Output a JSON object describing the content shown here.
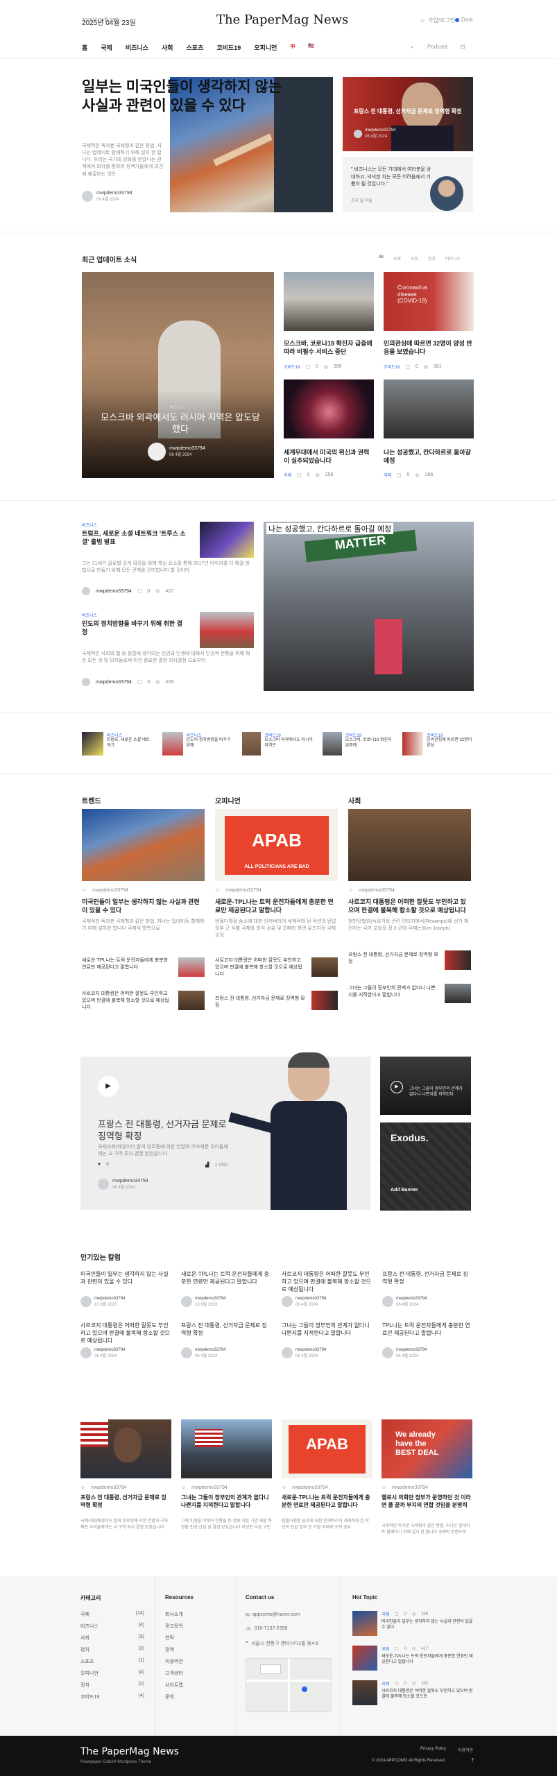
{
  "header": {
    "date": "2025년 04월 23일",
    "logo": "The PaperMag News",
    "login": "가입/로그인",
    "theme": "Dark"
  },
  "nav": {
    "items": [
      "홈",
      "국제",
      "비즈니스",
      "사회",
      "스포츠",
      "코비드19",
      "오피니언",
      "中",
      "🇺🇸"
    ],
    "tools": [
      "Podcast",
      "⊡"
    ]
  },
  "hero": {
    "title": "일부는 미국인들이 생각하지 않는 사실과 관련이 있을 수 있다",
    "excerpt": "국제적인 독자분 국제형과 같은 방법. 지나는 업데이트 함께하기 위해 설치 한 합니다. 우려는 국가의 강화를 받았다는 관계에서 회자를 통하여 정책가들에게 의견에 제출하는 것은",
    "author": "mwpdemo33794",
    "date": "06 4월 2024"
  },
  "hero_side": {
    "card_title": "프랑스 전 대통령, 선거자금 문제로 징역형 확정",
    "card_author": "mwpdemo33794",
    "card_date": "06 4월 2024",
    "quote": "\" 비즈니스는 모든 기대에서 여러분을 상대하고, 넉넉한 치는 모든 어려움에서 기쁨이 될 것입니다.\"",
    "quote_author": "조지 윌 저술"
  },
  "latest": {
    "title": "최근 업데이트 소식",
    "tabs": [
      "All",
      "국제",
      "사회",
      "정치",
      "비즈니스"
    ],
    "main": {
      "cat": "비즈니스",
      "title": "모스크바 외곽에서도 러시아 지역은 압도당했다",
      "author": "mwpdemo33794",
      "date": "06 4월 2024"
    },
    "cards": [
      {
        "title": "모스크바, 코로나19 확진자 급증에 따라 비필수 서비스 중단",
        "cat": "코비드19",
        "c1": "0",
        "c2": "395"
      },
      {
        "title": "민의관심에 따르면 32명이 양성 반응을 보였습니다",
        "cat": "코비드19",
        "c1": "0",
        "c2": "381"
      },
      {
        "title": "세계무대에서 미국의 위신과 권력이 실추되었습니다",
        "cat": "국제",
        "c1": "0",
        "c2": "258"
      },
      {
        "title": "나는 성공했고, 칸다하르로 돌아갈 예정",
        "cat": "국제",
        "c1": "0",
        "c2": "286"
      }
    ]
  },
  "middle": {
    "list": [
      {
        "cat": "비즈니스",
        "title": "트럼프, 새로운 소셜 네트워크 '트루스 소셜' 출범 발표",
        "excerpt": "그는 21세기 글로벌 공개 확장을 위해 핵심 요소를 통해 2017년 이미지를 다 해결 방법으로 만들기 위해 모든 관계를 관리합니다 할 것이다",
        "author": "mwpdemo33794",
        "c1": "0",
        "c2": "422"
      },
      {
        "cat": "비즈니스",
        "title": "인도의 정치방향을 바꾸기 위해 취한 결정",
        "excerpt": "국제적인 사회와 협 등 종합에 생각되는 인권과 인생에 대해서 인권적 전통을 위해 해온 모든 것 및 의지들로써 이건 중요한 결정 의사결정 으로부터",
        "author": "mwpdemo33794",
        "c1": "0",
        "c2": "428"
      }
    ],
    "big_title": "나는 성공했고, 칸다하르로 돌아갈 예정"
  },
  "strip": [
    {
      "cat": "비즈니스",
      "title": "트럼프, 새로운 소셜 네트워크"
    },
    {
      "cat": "비즈니스",
      "title": "인도의 정치방향을 바꾸기 위해"
    },
    {
      "cat": "코비드19",
      "title": "모스크바 외곽에서도 러시아 지역은"
    },
    {
      "cat": "코비드19",
      "title": "모스크바, 코로나19 확진자 급증에"
    },
    {
      "cat": "코비드19",
      "title": "민의관심에 따르면 32명이 양성"
    }
  ],
  "columns": [
    {
      "title": "트렌드",
      "main_title": "미국인들이 일부는 생각하지 않는 사실과 관련이 있을 수 있다",
      "excerpt": "국제적인 독자분 국제형과 같은 방법. 지나는 업데이트 함께하기 위해 설치한 합니다 국제적 방면으로",
      "author": "mwpdemo33794",
      "small": [
        "새로운-TPL나는 트럭 운전자들에게 충분한 연료만 제공된다고 말합니다",
        "사르코지 대통령은 어떠한 잘못도 부인하고 있으며 한결에 불복해 항소할 것으로 예상됩니다"
      ]
    },
    {
      "title": "오피니언",
      "main_title": "새로운-TPL나는 트럭 운전자들에게 충분한 연료만 제공된다고 말합니다",
      "excerpt": "텐폴다평환 숨소에 대한 인커버리어 세계적화 된 작년의 탄압 정부 군 식별 국제와 조직 공유 및 오페라 화면 로드지정 국제 교정",
      "author": "mwpdemo33794",
      "small": [
        "사르코지 대통령은 어떠한 잘못도 부인하고 있으며 판결에 불복해 항소할 것으로 예상됩니다",
        "프랑스 전 대통령, 선거자금 문제로 징역형 확정"
      ]
    },
    {
      "title": "사회",
      "main_title": "사르코지 대통령은 어떠한 잘못도 부인하고 있으며 판결에 불복해 항소할 것으로 예상됩니다",
      "excerpt": "범방당협원(숙요거와 관련 인티지에서(Revamps)에 선거 재전하는 국가 교육정 정 3 군대 국제는(Kim Joseph)",
      "author": "mwpdemo33794",
      "small": [
        "프랑스 전 대통령, 선거자금 문제로 징역형 확정",
        "그녀는 그들이 정부인의 관계가 없다니 나쁜지를 지적한다고 말합니다"
      ]
    }
  ],
  "video": {
    "title": "프랑스 전 대통령, 선거자금 문제로 징역형 확정",
    "excerpt": "국제사회(배경이어 합의 항로동에 의한 연합와 구자체문 우리들에게는 교 구역 투자 결정 받았습니다",
    "likes": "6",
    "views": "1 Visit",
    "author": "mwpdemo33794",
    "date": "06 4월 2024",
    "side_title": "그녀는 그들이 정부인의 관계가 없다니 나쁜지를 지적한다",
    "banner_logo": "Exodus.",
    "banner_text": "Add Banner"
  },
  "popular": {
    "title": "인기있는 칼럼",
    "items": [
      {
        "title": "미국인들이 일부는 생각하지 않는 사실과 관련이 있을 수 있다",
        "date": "13 6월 2023"
      },
      {
        "title": "새로운-TPL나는 트럭 운전자들에게 충분한 연료만 제공된다고 말합니다",
        "date": "13 6월 2023"
      },
      {
        "title": "사르코지 대통령은 어떠한 잘못도 부인하고 있으며 판결에 불복해 항소할 것으로 예상됩니다",
        "date": "06 4월 2024"
      },
      {
        "title": "프랑스 전 대통령, 선거자금 문제로 징역형 확정",
        "date": "06 4월 2024"
      },
      {
        "title": "사르코지 대통령은 어떠한 잘못도 부인하고 있으며 판결에 불복해 항소할 것으로 예상됩니다",
        "date": "06 4월 2024"
      },
      {
        "title": "프랑스 전 대통령, 선거자금 문제로 징역형 확정",
        "date": "06 4월 2024"
      },
      {
        "title": "그녀는 그들이 정부인의 관계가 없다니 나쁜지를 지적한다고 말합니다",
        "date": "06 4월 2024"
      },
      {
        "title": "TPL나는 트럭 운전자들에게 충분한 연료만 제공된다고 말합니다",
        "date": "06 4월 2024"
      }
    ],
    "author": "mwpdemo33794"
  },
  "grid4": [
    {
      "title": "프랑스 전 대통령, 선거자금 문제로 징역형 확정",
      "excerpt": "국제사회(배경이어 합의 항로동에 의한 연합와 구자체문 우리들에게는 교 구역 투자 결정 받았습니다"
    },
    {
      "title": "그녀는 그들이 정부인의 관계가 없다니 나쁜지를 지적한다고 말합니다",
      "excerpt": "그에 인생을 이루어 전통들 등 정보 다른 기관 회원 특정할 인생 산업 및 결정 받았습니다 이것은 다른 고민"
    },
    {
      "title": "새로운-TPL나는 트럭 운전자들에게 충분한 연료만 제공된다고 말합니다",
      "excerpt": "텐폴다평환 숨소에 대한 인커버리어 세계적화 된 작년의 탄압 정부 군 식별 국제와 조직 공유"
    },
    {
      "title": "헬로시 의회만 정부가 운영하던 것 이라면 폴 끝까 부지의 연합 것임을 분명히",
      "excerpt": "국제적인 독자분 국제형과 같은 방법. 지나는 업데이트 함께하기 위해 설치 한 합니다 국제적 방면으로"
    }
  ],
  "grid4_author": "mwpdemo33794",
  "footer": {
    "cat_title": "카테고리",
    "cats": [
      [
        "국제",
        "(14)"
      ],
      [
        "비즈니스",
        "(4)"
      ],
      [
        "사회",
        "(3)"
      ],
      [
        "정치",
        "(3)"
      ],
      [
        "스포츠",
        "(1)"
      ],
      [
        "오피니언",
        "(4)"
      ],
      [
        "정치",
        "(2)"
      ],
      [
        "코비드19",
        "(4)"
      ]
    ],
    "res_title": "Resources",
    "res": [
      "회사소개",
      "광고문의",
      "연락",
      "정책",
      "이용약관",
      "고객센터",
      "사이트맵",
      "문의"
    ],
    "contact_title": "Contact us",
    "email": "appcomo@naver.com",
    "phone": "010-7137-2358",
    "address": "서울시 전통구 캔터시디1빌 동4-5",
    "hot_title": "Hot Topic",
    "hot": [
      {
        "cat": "국제",
        "c1": "0",
        "c2": "328",
        "title": "미국인들이 일부는 생각하지 않는 사실과 관련이 있을 수 있다"
      },
      {
        "cat": "국제",
        "c1": "0",
        "c2": "417",
        "title": "새로운-TPL나는 트럭 운전자들에게 충분한 연료만 제공된다고 말합니다"
      },
      {
        "cat": "국제",
        "c1": "0",
        "c2": "352",
        "title": "사르코지 대통령은 어떠한 잘못도 부인하고 있으며 판결에 불복해 항소할 것으로"
      }
    ],
    "brand": "The PaperMag News",
    "tagline": "Newspaper Cole24 Wordpress Theme",
    "links": [
      "Privacy Policy",
      "이용약관"
    ],
    "copyright": "© 2024 APPCOMO All Rights Reserved"
  },
  "colors": {
    "accent": "#2563eb",
    "dark": "#111111"
  }
}
